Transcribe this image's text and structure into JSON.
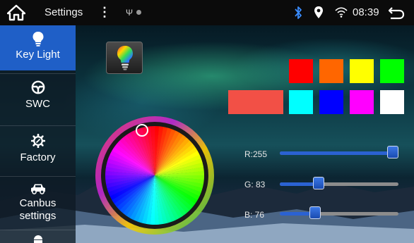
{
  "status_bar": {
    "title": "Settings",
    "usb_symbol": "Ψ",
    "time": "08:39",
    "icons": [
      "home-icon",
      "menu-dots-icon",
      "usb-icon",
      "bluetooth-icon",
      "location-icon",
      "wifi-icon",
      "back-icon"
    ]
  },
  "sidebar": {
    "items": [
      {
        "label": "Key Light",
        "icon": "bulb-icon",
        "active": true
      },
      {
        "label": "SWC",
        "icon": "steering-wheel-icon",
        "active": false
      },
      {
        "label": "Factory",
        "icon": "gear-icon",
        "active": false
      },
      {
        "label": "Canbus\nsettings",
        "icon": "car-icon",
        "active": false
      },
      {
        "label": "",
        "icon": "android-icon",
        "active": false
      }
    ]
  },
  "main": {
    "bulb_button_icon": "rgb-bulb-icon",
    "preview_color": "#F25046",
    "swatches": [
      "#FF0000",
      "#FF6600",
      "#FFFF00",
      "#00FF00",
      "#00FFFF",
      "#0000FF",
      "#FF00FF",
      "#FFFFFF"
    ],
    "sliders": [
      {
        "label": "R:255",
        "value": 255,
        "max": 255
      },
      {
        "label": "G: 83",
        "value": 83,
        "max": 255
      },
      {
        "label": "B: 76",
        "value": 76,
        "max": 255
      }
    ]
  },
  "colors": {
    "accent": "#1F5FC7",
    "slider_fill": "#2B62D2"
  }
}
